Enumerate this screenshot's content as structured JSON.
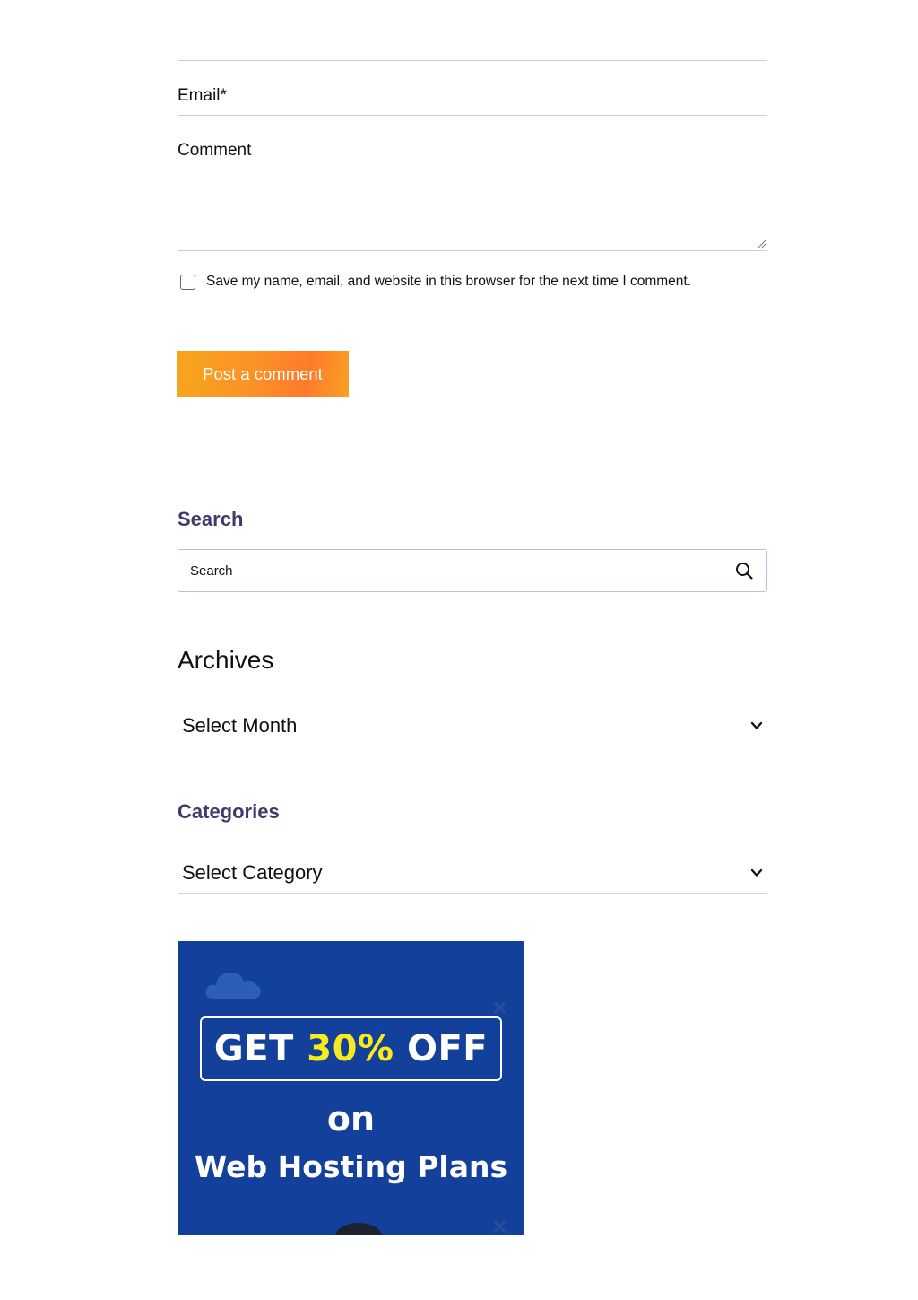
{
  "form": {
    "email_label": "Email*",
    "comment_label": "Comment",
    "save_text": "Save my name, email, and website in this browser for the next time I comment.",
    "post_button": "Post a comment"
  },
  "widgets": {
    "search_title": "Search",
    "search_placeholder": "Search",
    "archives_title": "Archives",
    "archives_select": "Select Month",
    "categories_title": "Categories",
    "categories_select": "Select Category"
  },
  "banner": {
    "get": "GET",
    "percent": "30%",
    "off": "OFF",
    "on": "on",
    "plans": "Web Hosting Plans",
    "colors": {
      "background": "#13409a",
      "highlight": "#f8ea1d"
    }
  },
  "colors": {
    "button_gradient_start": "#f7a61c",
    "button_gradient_end": "#ff7a2a",
    "widget_title": "#3d3b6b"
  }
}
